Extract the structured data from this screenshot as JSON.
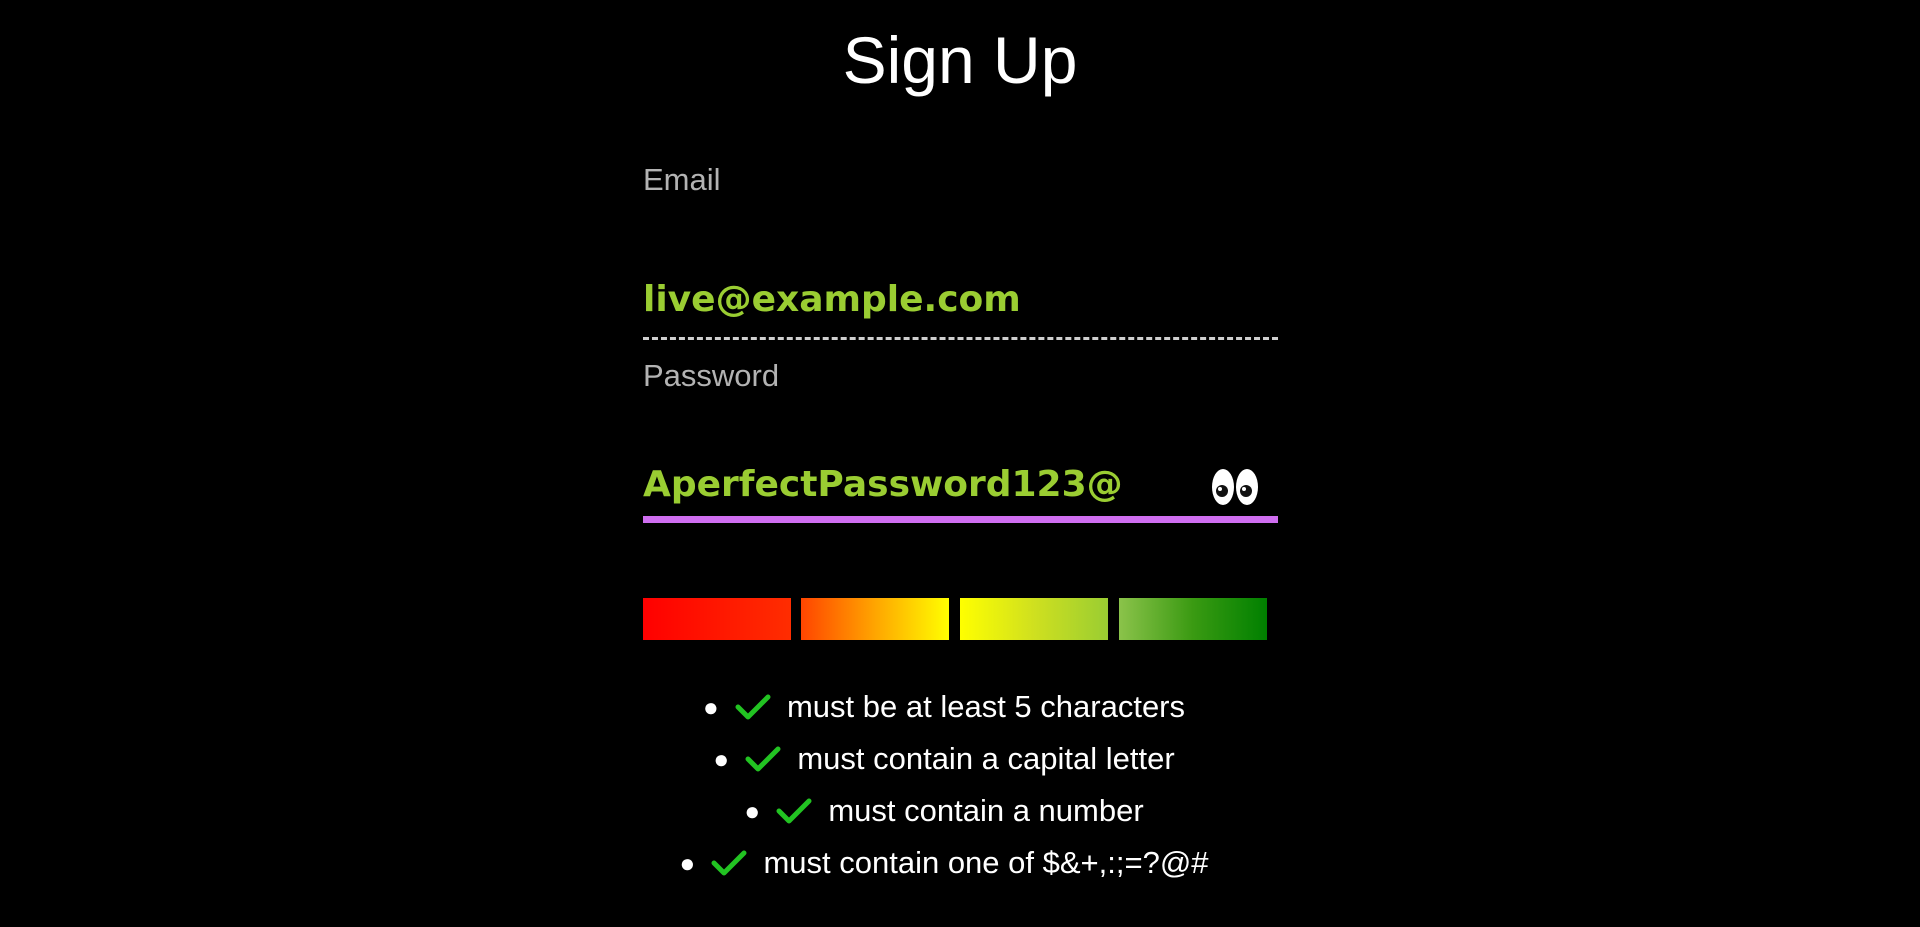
{
  "page": {
    "title": "Sign Up"
  },
  "email": {
    "label": "Email",
    "value": "live@example.com"
  },
  "password": {
    "label": "Password",
    "value": "AperfectPassword123@",
    "toggle_icon": "eyes-icon"
  },
  "strength": {
    "level": 4,
    "max": 4,
    "colors": [
      "#ff0000",
      "#ffa500",
      "#ffff00",
      "#008000"
    ]
  },
  "rules": [
    {
      "text": "must be at least 5 characters",
      "met": true
    },
    {
      "text": "must contain a capital letter",
      "met": true
    },
    {
      "text": "must contain a number",
      "met": true
    },
    {
      "text": "must contain one of $&+,:;=?@#",
      "met": true
    }
  ],
  "colors": {
    "background": "#000000",
    "input_text": "#9acd32",
    "label": "#b3b3b3",
    "focus_underline": "#cf6ef0",
    "check": "#22c322"
  }
}
